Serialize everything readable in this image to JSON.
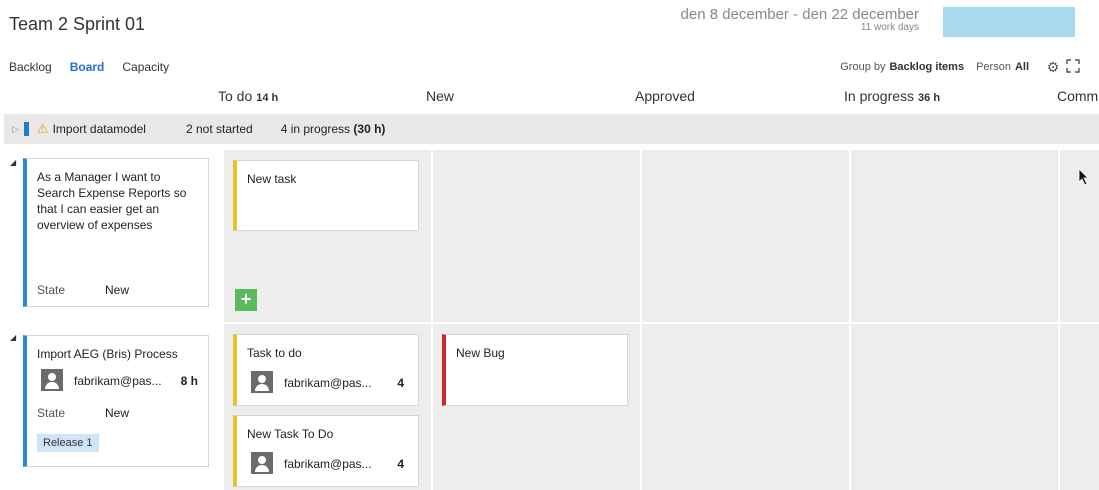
{
  "sprint": {
    "title": "Team 2 Sprint 01",
    "date_range": "den 8 december - den 22 december",
    "work_days": "11 work days"
  },
  "nav": {
    "backlog": "Backlog",
    "board": "Board",
    "capacity": "Capacity"
  },
  "toolbar": {
    "group_by_label": "Group by",
    "group_by_value": "Backlog items",
    "person_label": "Person",
    "person_value": "All"
  },
  "columns": [
    {
      "name": "To do",
      "hours": "14 h"
    },
    {
      "name": "New",
      "hours": ""
    },
    {
      "name": "Approved",
      "hours": ""
    },
    {
      "name": "In progress",
      "hours": "36 h"
    },
    {
      "name": "Comm",
      "hours": ""
    }
  ],
  "summary": {
    "title": "Import datamodel",
    "not_started": "2 not started",
    "in_progress_text": "4 in progress",
    "in_progress_hours": "(30 h)"
  },
  "lanes": [
    {
      "pbi": {
        "title": "As a Manager I want to Search Expense Reports so that I can easier get an overview of expenses",
        "state_label": "State",
        "state_value": "New"
      },
      "todo_tasks": [
        {
          "title": "New task"
        }
      ]
    },
    {
      "pbi": {
        "title": "Import AEG (Bris) Process",
        "assignee": "fabrikam@pas...",
        "hours": "8 h",
        "state_label": "State",
        "state_value": "New",
        "tag": "Release 1"
      },
      "todo_tasks": [
        {
          "title": "Task to do",
          "assignee": "fabrikam@pas...",
          "remaining": "4"
        },
        {
          "title": "New Task To Do",
          "assignee": "fabrikam@pas...",
          "remaining": "4"
        }
      ],
      "new_items": [
        {
          "title": "New Bug"
        }
      ]
    }
  ],
  "colors": {
    "pbi": "#2c8ad0",
    "task": "#f0bd2c",
    "bug": "#cc2a2a",
    "add": "#5cb85c",
    "accent": "#1f6fd1",
    "header_box": "#a9d9ec"
  }
}
